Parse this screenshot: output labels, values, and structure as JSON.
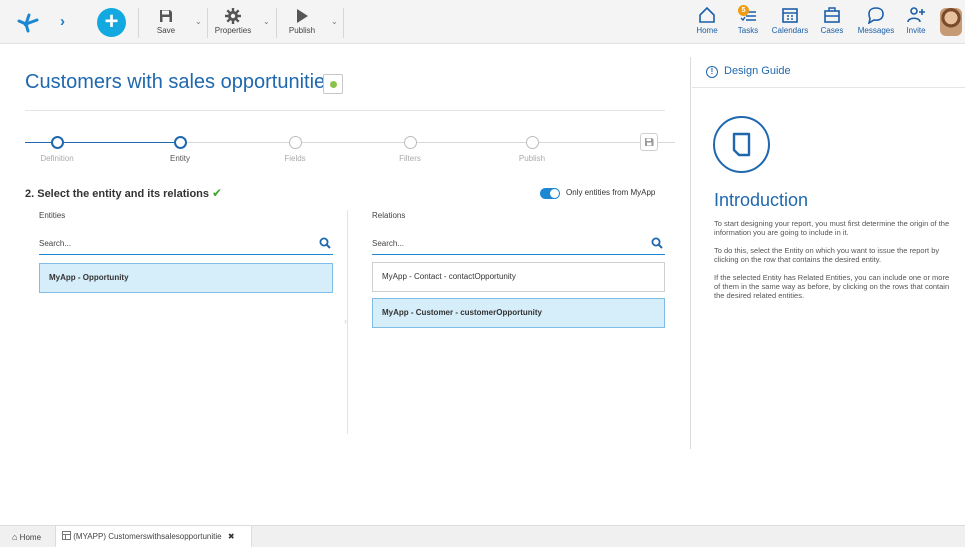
{
  "toolbar": {
    "save_label": "Save",
    "properties_label": "Properties",
    "publish_label": "Publish",
    "add_icon": "+"
  },
  "nav": {
    "home_label": "Home",
    "tasks_label": "Tasks",
    "tasks_badge": "5",
    "calendars_label": "Calendars",
    "cases_label": "Cases",
    "messages_label": "Messages",
    "invite_label": "Invite"
  },
  "page": {
    "title": "Customers with sales opportunities",
    "status_color": "#8bc34a"
  },
  "wizard": {
    "steps": [
      "Definition",
      "Entity",
      "Fields",
      "Filters",
      "Publish"
    ],
    "current_step": 2,
    "accent_color": "#1f68ae"
  },
  "selection": {
    "heading": "2. Select the entity and its relations",
    "toggle_label": "Only entities from MyApp",
    "toggle_on": true
  },
  "entities": {
    "label": "Entities",
    "search_placeholder": "Search...",
    "items": [
      "MyApp - Opportunity"
    ]
  },
  "relations": {
    "label": "Relations",
    "search_placeholder": "Search...",
    "items": [
      "MyApp - Contact - contactOpportunity",
      "MyApp - Customer - customerOpportunity"
    ]
  },
  "guide": {
    "header": "Design Guide",
    "title": "Introduction",
    "paragraphs": [
      "To start designing your report, you must first determine the origin of the information you are going to include in it.",
      "To do this, select the Entity on which you want to issue the report by clicking on the row that contains the desired entity.",
      "If the selected Entity has Related Entities, you can include one or more of them in the same way as before, by clicking on the rows that contain the desired related entities."
    ]
  },
  "tabs": {
    "home_label": "Home",
    "doc_label": "(MYAPP) Customerswithsalesopportunitie"
  }
}
